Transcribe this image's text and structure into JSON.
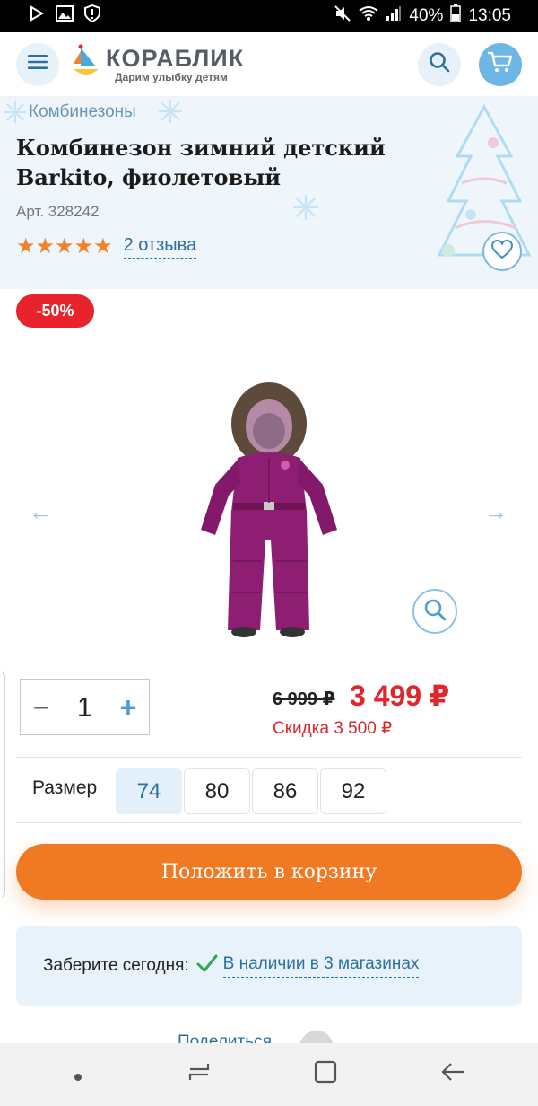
{
  "status_bar": {
    "battery": "40%",
    "time": "13:05"
  },
  "header": {
    "logo_title": "КОРАБЛИК",
    "logo_tagline": "Дарим улыбку детям"
  },
  "product": {
    "breadcrumb": "Комбинезоны",
    "title": "Комбинезон зимний детский Barkito, фиолетовый",
    "article": "Арт. 328242",
    "rating_stars": "★★★★★",
    "rating_value": 5,
    "reviews_link": "2 отзыва",
    "discount_badge": "-50%",
    "gallery_prev": "←",
    "gallery_next": "→"
  },
  "purchase": {
    "qty_minus": "−",
    "qty_value": "1",
    "qty_plus": "+",
    "old_price": "6 999 ₽",
    "new_price": "3 499 ₽",
    "saving": "Скидка 3 500 ₽",
    "size_label": "Размер",
    "sizes": [
      "74",
      "80",
      "86",
      "92"
    ],
    "selected_size": "74",
    "add_to_cart": "Положить в корзину"
  },
  "availability": {
    "label": "Заберите сегодня:",
    "link": "В наличии в 3 магазинах"
  },
  "share": {
    "label": "Поделиться"
  },
  "colors": {
    "accent_blue": "#6db6e6",
    "cta_orange": "#f07a24",
    "sale_red": "#e3242b",
    "star_orange": "#f0832c",
    "product_purple": "#8e1e72"
  },
  "icons": [
    "menu-icon",
    "search-icon",
    "cart-icon",
    "heart-icon",
    "zoom-icon",
    "check-icon",
    "share-icon"
  ]
}
